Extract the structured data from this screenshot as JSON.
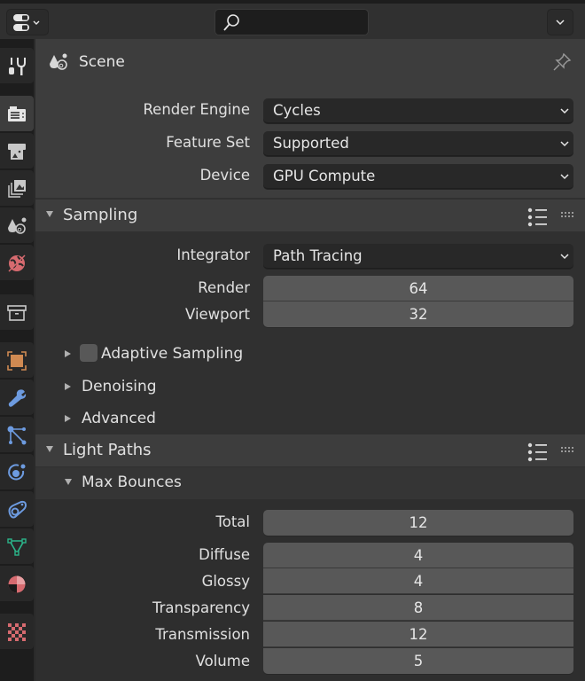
{
  "header": {
    "editor_type_icon": "properties-editor-icon",
    "search": {
      "value": "",
      "placeholder": ""
    },
    "options_icon": "chevron-down-icon"
  },
  "sidebar": {
    "tabs": [
      {
        "name": "tool",
        "icon": "tool-icon",
        "active": false
      },
      {
        "name": "render",
        "icon": "render-camera-icon",
        "active": true
      },
      {
        "name": "output",
        "icon": "output-printer-icon",
        "active": false
      },
      {
        "name": "view-layer",
        "icon": "view-layer-icon",
        "active": false
      },
      {
        "name": "scene",
        "icon": "scene-icon",
        "active": false
      },
      {
        "name": "world",
        "icon": "world-icon",
        "active": false
      },
      {
        "name": "collection",
        "icon": "collection-box-icon",
        "active": false
      },
      {
        "name": "object",
        "icon": "object-icon",
        "active": false
      },
      {
        "name": "modifiers",
        "icon": "wrench-icon",
        "active": false
      },
      {
        "name": "particles",
        "icon": "particles-icon",
        "active": false
      },
      {
        "name": "physics",
        "icon": "physics-icon",
        "active": false
      },
      {
        "name": "constraints",
        "icon": "constraints-icon",
        "active": false
      },
      {
        "name": "data",
        "icon": "mesh-data-icon",
        "active": false
      },
      {
        "name": "material",
        "icon": "material-icon",
        "active": false
      },
      {
        "name": "texture",
        "icon": "texture-checker-icon",
        "active": false
      }
    ]
  },
  "context": {
    "title": "Scene"
  },
  "render": {
    "render_engine": {
      "label": "Render Engine",
      "value": "Cycles"
    },
    "feature_set": {
      "label": "Feature Set",
      "value": "Supported"
    },
    "device": {
      "label": "Device",
      "value": "GPU Compute"
    }
  },
  "sampling": {
    "title": "Sampling",
    "integrator": {
      "label": "Integrator",
      "value": "Path Tracing"
    },
    "render": {
      "label": "Render",
      "value": "64"
    },
    "viewport": {
      "label": "Viewport",
      "value": "32"
    },
    "subpanels": {
      "adaptive": {
        "label": "Adaptive Sampling",
        "checked": false
      },
      "denoising": {
        "label": "Denoising"
      },
      "advanced": {
        "label": "Advanced"
      }
    }
  },
  "light_paths": {
    "title": "Light Paths",
    "max_bounces": {
      "title": "Max Bounces",
      "total": {
        "label": "Total",
        "value": "12"
      },
      "diffuse": {
        "label": "Diffuse",
        "value": "4"
      },
      "glossy": {
        "label": "Glossy",
        "value": "4"
      },
      "transparency": {
        "label": "Transparency",
        "value": "8"
      },
      "transmission": {
        "label": "Transmission",
        "value": "12"
      },
      "volume": {
        "label": "Volume",
        "value": "5"
      }
    }
  },
  "colors": {
    "accent_orange": "#d08a52",
    "accent_blue": "#6d9be0",
    "accent_green": "#2bb58a",
    "accent_red": "#d66a6f"
  }
}
